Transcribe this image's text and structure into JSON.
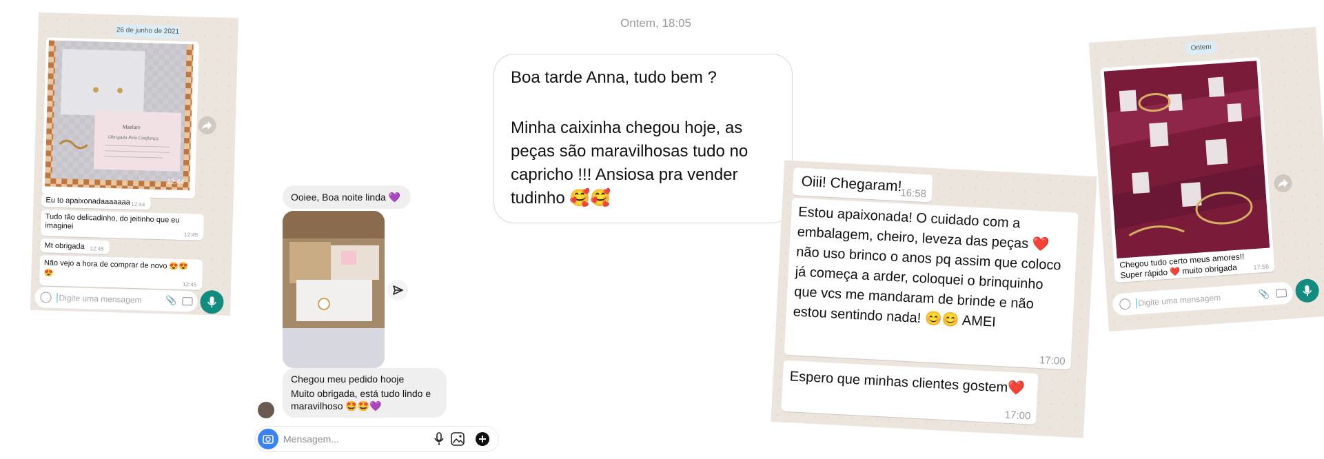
{
  "card1": {
    "date_chip": "26 de junho de 2021",
    "photo_time": "12:44",
    "messages": [
      {
        "text": "Eu to apaixonadaaaaaaa",
        "time": "12:44"
      },
      {
        "text": "Tudo tão delicadinho, do jeitinho que eu imaginei",
        "time": "12:45"
      },
      {
        "text": "Mt obrigada",
        "time": "12:45"
      },
      {
        "text": "Não vejo a hora de comprar de novo 😍😍😍",
        "time": "12:45"
      }
    ],
    "input_placeholder": "Digite uma mensagem",
    "card_text": {
      "brand": "Maelare",
      "thanks": "Obrigada Pela Confiança"
    }
  },
  "card2": {
    "messages": {
      "first": "Ooiee, Boa noite linda 💜",
      "second_line1": "Chegou meu pedido hooje",
      "second_line2": "Muito obrigada, está tudo lindo e maravilhoso 🤩🤩💜"
    },
    "input_placeholder": "Mensagem..."
  },
  "card3": {
    "timestamp": "Ontem, 18:05",
    "line1": "Boa tarde Anna, tudo bem ?",
    "line2": "Minha caixinha chegou hoje, as peças são maravilhosas tudo no capricho !!! Ansiosa pra vender tudinho 🥰🥰"
  },
  "card4": {
    "messages": [
      {
        "text": "Oiii! Chegaram!",
        "time": "16:58"
      },
      {
        "text": "Estou apaixonada! O cuidado com a embalagem, cheiro, leveza das peças ❤️ não uso brinco o anos pq assim que coloco já começa a arder, coloquei o brinquinho que vcs me mandaram de brinde e não estou sentindo nada! 😊😊 AMEI",
        "time": "17:00"
      },
      {
        "text": "Espero que minhas clientes gostem❤️",
        "time": "17:00"
      }
    ]
  },
  "card5": {
    "date_chip": "Ontem",
    "message": {
      "text": "Chegou tudo certo meus amores!! Super rápido ❤️ muito obrigada",
      "time": "17:56"
    },
    "input_placeholder": "Digite uma mensagem"
  },
  "colors": {
    "whatsapp_bg": "#ece5dd",
    "whatsapp_green": "#128c7e",
    "date_chip": "#dbeef7",
    "instagram_bubble": "#efefef",
    "instagram_blue": "#3b82f6",
    "maroon_fabric": "#7a1b3a"
  },
  "icons": [
    "emoji-icon",
    "attach-icon",
    "camera-icon",
    "mic-icon",
    "forward-icon",
    "send-icon",
    "gallery-icon",
    "plus-icon"
  ]
}
